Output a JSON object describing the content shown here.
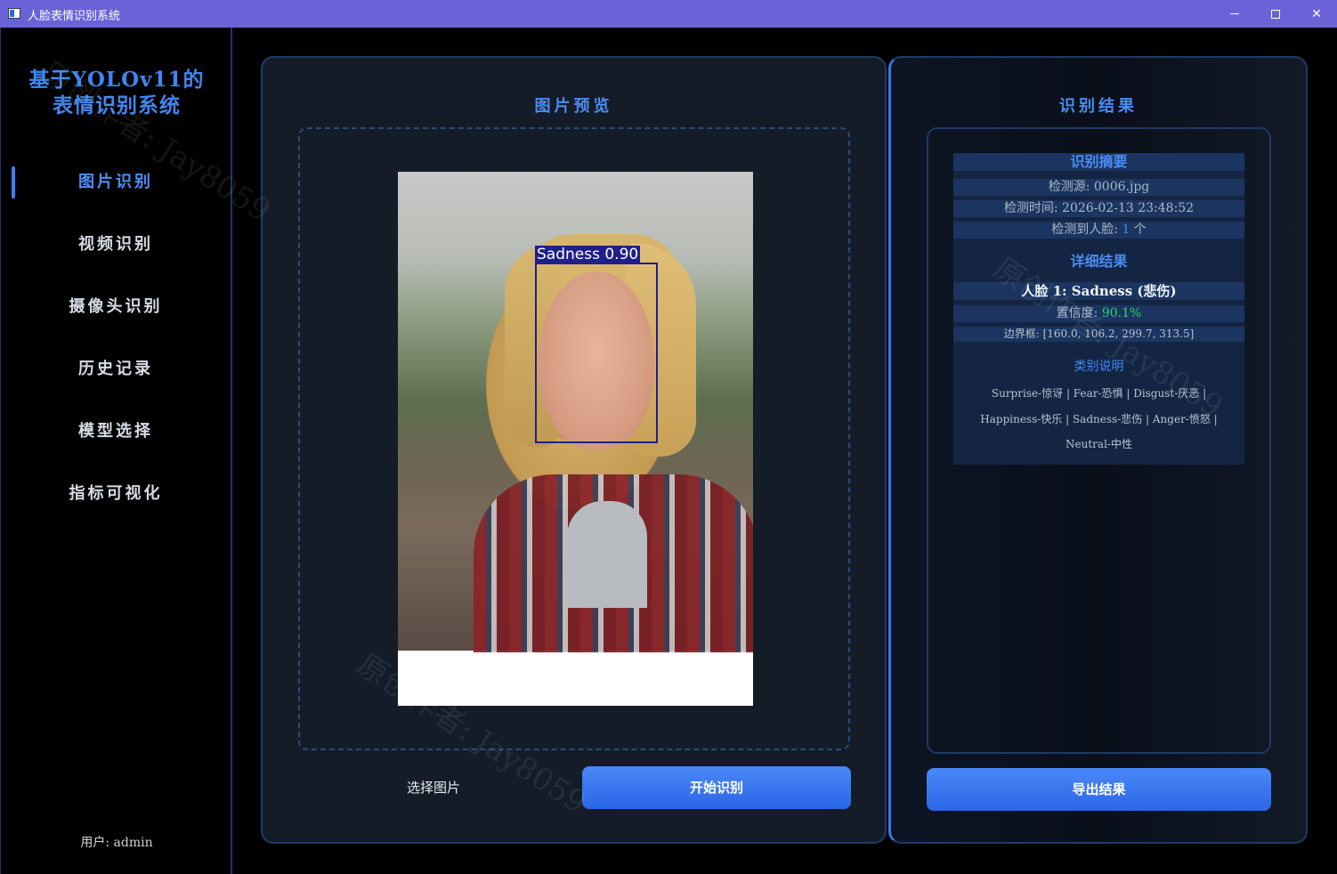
{
  "window": {
    "title": "人脸表情识别系统"
  },
  "sidebar": {
    "brand_line1": "基于YOLOv11的",
    "brand_line2": "表情识别系统",
    "items": [
      {
        "label": "图片识别",
        "active": true
      },
      {
        "label": "视频识别",
        "active": false
      },
      {
        "label": "摄像头识别",
        "active": false
      },
      {
        "label": "历史记录",
        "active": false
      },
      {
        "label": "模型选择",
        "active": false
      },
      {
        "label": "指标可视化",
        "active": false
      }
    ],
    "user_label": "用户: admin"
  },
  "preview": {
    "title": "图片预览",
    "detection_label": "Sadness 0.90",
    "select_button": "选择图片",
    "start_button": "开始识别"
  },
  "results": {
    "title": "识别结果",
    "summary_title": "识别摘要",
    "source": "检测源: 0006.jpg",
    "time": "检测时间: 2026-02-13 23:48:52",
    "faces_prefix": "检测到人脸: ",
    "faces_count": "1",
    "faces_suffix": " 个",
    "detail_title": "详细结果",
    "face_line": "人脸 1: Sadness (悲伤)",
    "confidence_prefix": "置信度: ",
    "confidence_value": "90.1%",
    "bbox": "边界框: [160.0, 106.2, 299.7, 313.5]",
    "category_title": "类别说明",
    "category_line1": "Surprise-惊讶 | Fear-恐惧 | Disgust-厌恶 |",
    "category_line2": "Happiness-快乐 | Sadness-悲伤 | Anger-愤怒 |",
    "category_line3": "Neutral-中性",
    "export_button": "导出结果"
  },
  "watermark": {
    "text1": "原创作者: Jay8059",
    "text2": "原创作者: Jay8059",
    "text3": "原创作者: Jay8059"
  },
  "colors": {
    "titlebar": "#6a63d8",
    "accent": "#3d7ff0",
    "confidence": "#2fcf6a"
  }
}
